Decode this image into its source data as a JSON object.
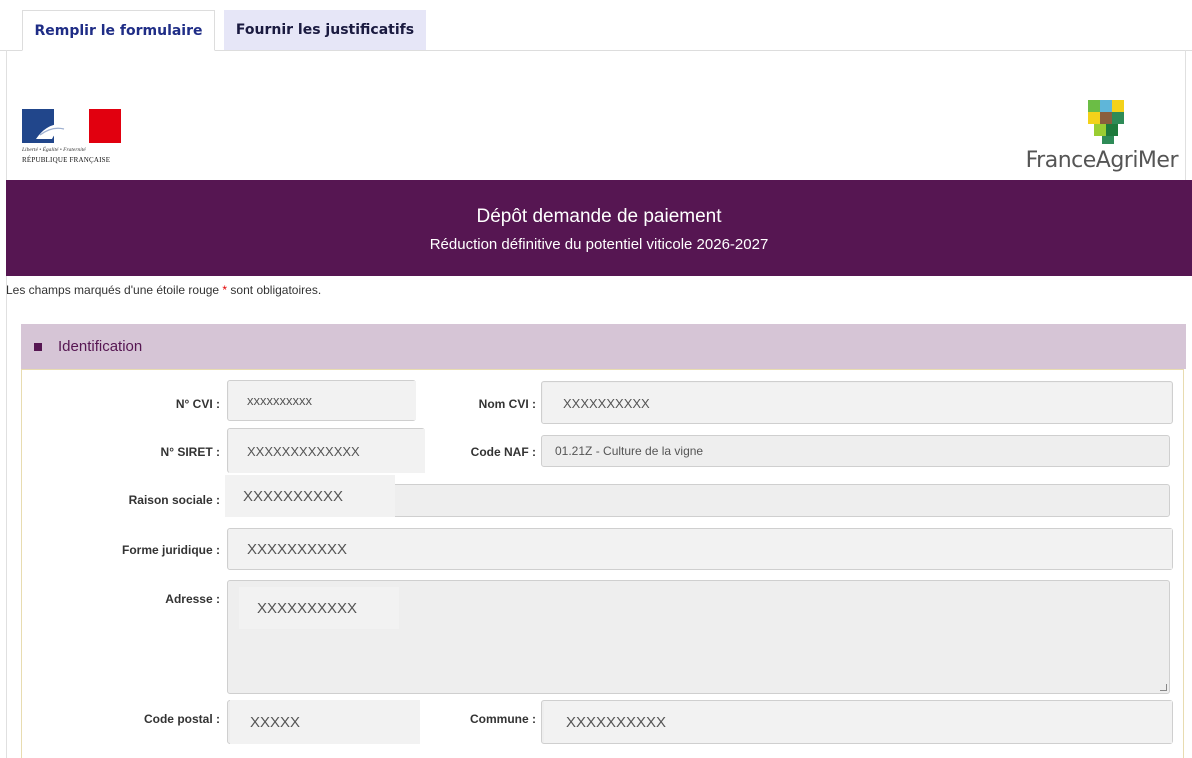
{
  "tabs": [
    {
      "label": "Remplir le formulaire",
      "active": true
    },
    {
      "label": "Fournir les justificatifs",
      "active": false
    }
  ],
  "logos": {
    "republique": {
      "motto": "Liberté • Égalité • Fraternité",
      "name": "RÉPUBLIQUE FRANÇAISE"
    },
    "franceagrimer": {
      "name": "FranceAgriMer"
    }
  },
  "banner": {
    "title": "Dépôt demande de paiement",
    "subtitle": "Réduction définitive du potentiel viticole 2026-2027"
  },
  "notice": {
    "before": "Les champs marqués d'une étoile rouge ",
    "star": "*",
    "after": " sont obligatoires."
  },
  "section": {
    "title": "Identification"
  },
  "fields": {
    "cvi": {
      "label": "N° CVI :",
      "value": "xxxxxxxxxx"
    },
    "nom_cvi": {
      "label": "Nom CVI :",
      "value": "XXXXXXXXXX"
    },
    "siret": {
      "label": "N° SIRET :",
      "value": "XXXXXXXXXXXXX"
    },
    "code_naf": {
      "label": "Code NAF :",
      "value": "01.21Z - Culture de la vigne"
    },
    "raison_sociale": {
      "label": "Raison sociale :",
      "value": "XXXXXXXXXX"
    },
    "forme_juridique": {
      "label": "Forme juridique :",
      "value": "XXXXXXXXXX"
    },
    "adresse": {
      "label": "Adresse :",
      "value": "XXXXXXXXXX"
    },
    "code_postal": {
      "label": "Code postal :",
      "value": "XXXXX"
    },
    "commune": {
      "label": "Commune :",
      "value": "XXXXXXXXXX"
    }
  },
  "colors": {
    "brand": "#561652",
    "section_bg": "#d6c5d6",
    "tab_active_text": "#1f2d86",
    "tab_inactive_bg": "#e6e6f7",
    "required_star": "#e30000"
  }
}
